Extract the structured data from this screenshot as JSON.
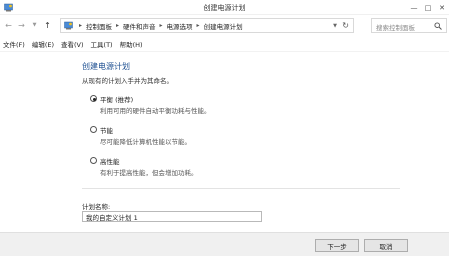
{
  "window": {
    "title": "创建电源计划"
  },
  "address": {
    "crumbs": [
      "控制面板",
      "硬件和声音",
      "电源选项",
      "创建电源计划"
    ],
    "search_placeholder": "搜索控制面板"
  },
  "menu": [
    "文件(F)",
    "编辑(E)",
    "查看(V)",
    "工具(T)",
    "帮助(H)"
  ],
  "main": {
    "heading": "创建电源计划",
    "subtitle": "从现有的计划入手并为其命名。",
    "options": [
      {
        "title": "平衡 (推荐)",
        "desc": "利用可用的硬件自动平衡功耗与性能。",
        "checked": true
      },
      {
        "title": "节能",
        "desc": "尽可能降低计算机性能以节能。",
        "checked": false
      },
      {
        "title": "高性能",
        "desc": "有利于提高性能，但会增加功耗。",
        "checked": false
      }
    ],
    "plan_name_label": "计划名称:",
    "plan_name_value": "我的自定义计划 1"
  },
  "buttons": {
    "next": "下一步",
    "cancel": "取消"
  }
}
